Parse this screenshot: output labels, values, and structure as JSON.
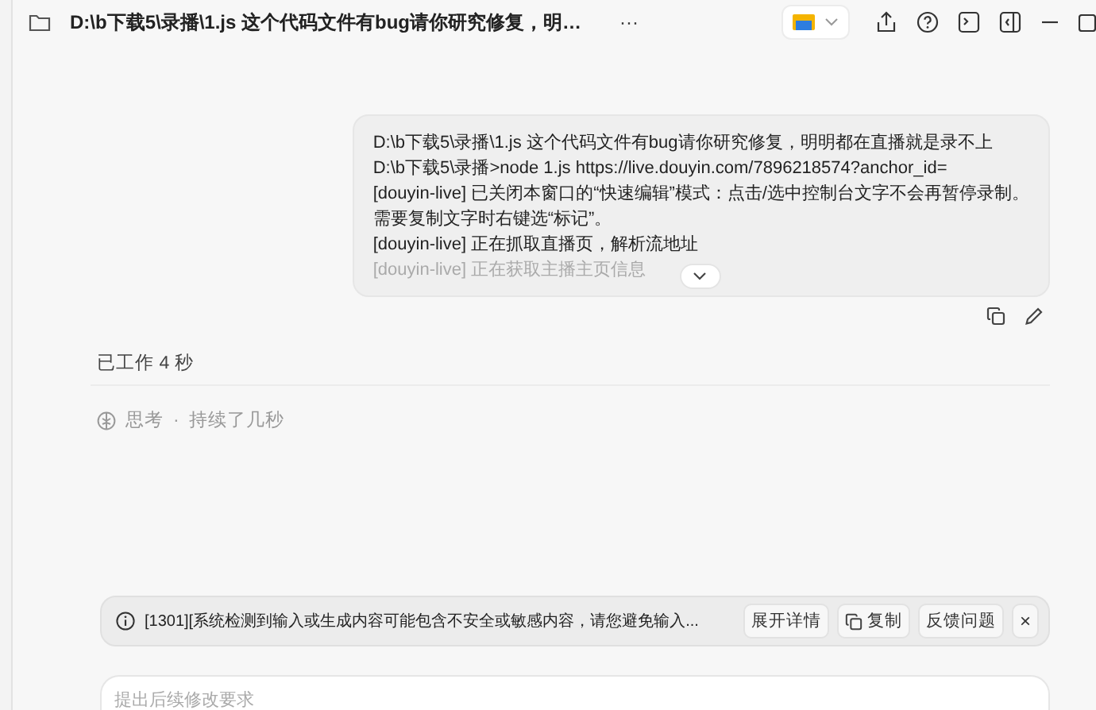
{
  "window": {
    "title": "D:\\b下载5\\录播\\1.js 这个代码文件有bug请你研究修复，明…",
    "more": "···"
  },
  "message": {
    "lines": [
      {
        "text": "D:\\b下载5\\录播\\1.js 这个代码文件有bug请你研究修复，明明都在直播就是录不上",
        "faded": false
      },
      {
        "text": "D:\\b下载5\\录播>node 1.js https://live.douyin.com/7896218574?anchor_id=",
        "faded": false
      },
      {
        "text": "[douyin-live] 已关闭本窗口的“快速编辑”模式：点击/选中控制台文字不会再暂停录制。",
        "faded": false
      },
      {
        "text": "需要复制文字时右键选“标记”。",
        "faded": false
      },
      {
        "text": "[douyin-live] 正在抓取直播页，解析流地址",
        "faded": false
      },
      {
        "text": "[douyin-live] 正在获取主播主页信息",
        "faded": true
      }
    ]
  },
  "status": {
    "worked": "已工作 4 秒"
  },
  "thinking": {
    "label": "思考",
    "separator": "·",
    "duration": "持续了几秒"
  },
  "alert": {
    "text": "[1301][系统检测到输入或生成内容可能包含不安全或敏感内容，请您避免输入...",
    "buttons": [
      {
        "kind": "text",
        "label": "展开详情"
      },
      {
        "kind": "copy",
        "label": "复制"
      },
      {
        "kind": "text",
        "label": "反馈问题"
      },
      {
        "kind": "close",
        "label": "×"
      }
    ]
  },
  "composer": {
    "placeholder": "提出后续修改要求"
  }
}
